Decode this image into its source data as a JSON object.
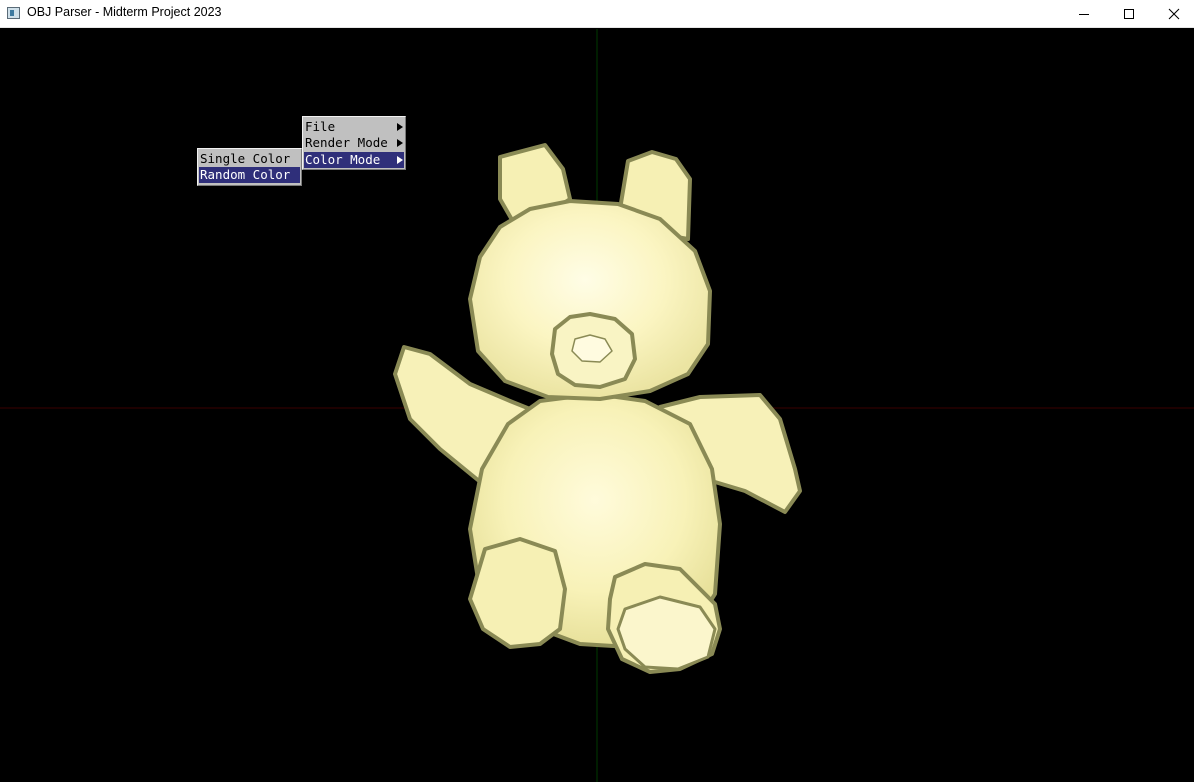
{
  "window": {
    "title": "OBJ Parser - Midterm Project 2023",
    "icon": "app-window-icon",
    "controls": {
      "minimize": "minimize-icon",
      "maximize": "maximize-icon",
      "close": "close-icon"
    }
  },
  "viewport": {
    "background_color": "#000000",
    "model": "teddy-bear",
    "model_color": "#f6f1b8",
    "outline_color": "#8a8a55",
    "x_axis_color": "#3a0000",
    "y_axis_color": "#003a00"
  },
  "context_menu": {
    "items": [
      {
        "label": "File",
        "has_submenu": true,
        "highlighted": false
      },
      {
        "label": "Render Mode",
        "has_submenu": true,
        "highlighted": false
      },
      {
        "label": "Color Mode",
        "has_submenu": true,
        "highlighted": true
      }
    ],
    "highlight_color": "#2f2f7a",
    "background_color": "#c0c0c0"
  },
  "color_submenu": {
    "items": [
      {
        "label": "Single Color",
        "highlighted": false
      },
      {
        "label": "Random Color",
        "highlighted": true
      }
    ]
  }
}
